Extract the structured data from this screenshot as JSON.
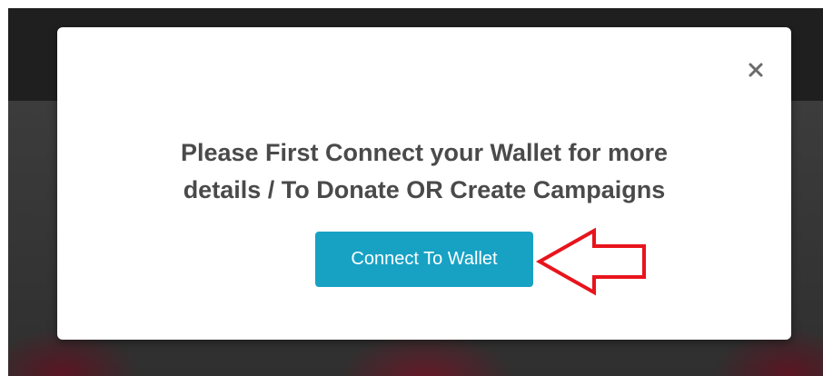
{
  "modal": {
    "close_label": "×",
    "message_line1": "Please First Connect your Wallet for more",
    "message_line2": "details / To Donate OR Create Campaigns",
    "connect_button_label": "Connect To Wallet"
  },
  "colors": {
    "button_bg": "#17a2c4",
    "message_text": "#4a4a4a",
    "annotation_arrow": "#e8141c"
  },
  "icons": {
    "close": "close-icon",
    "annotation": "arrow-left-icon"
  }
}
